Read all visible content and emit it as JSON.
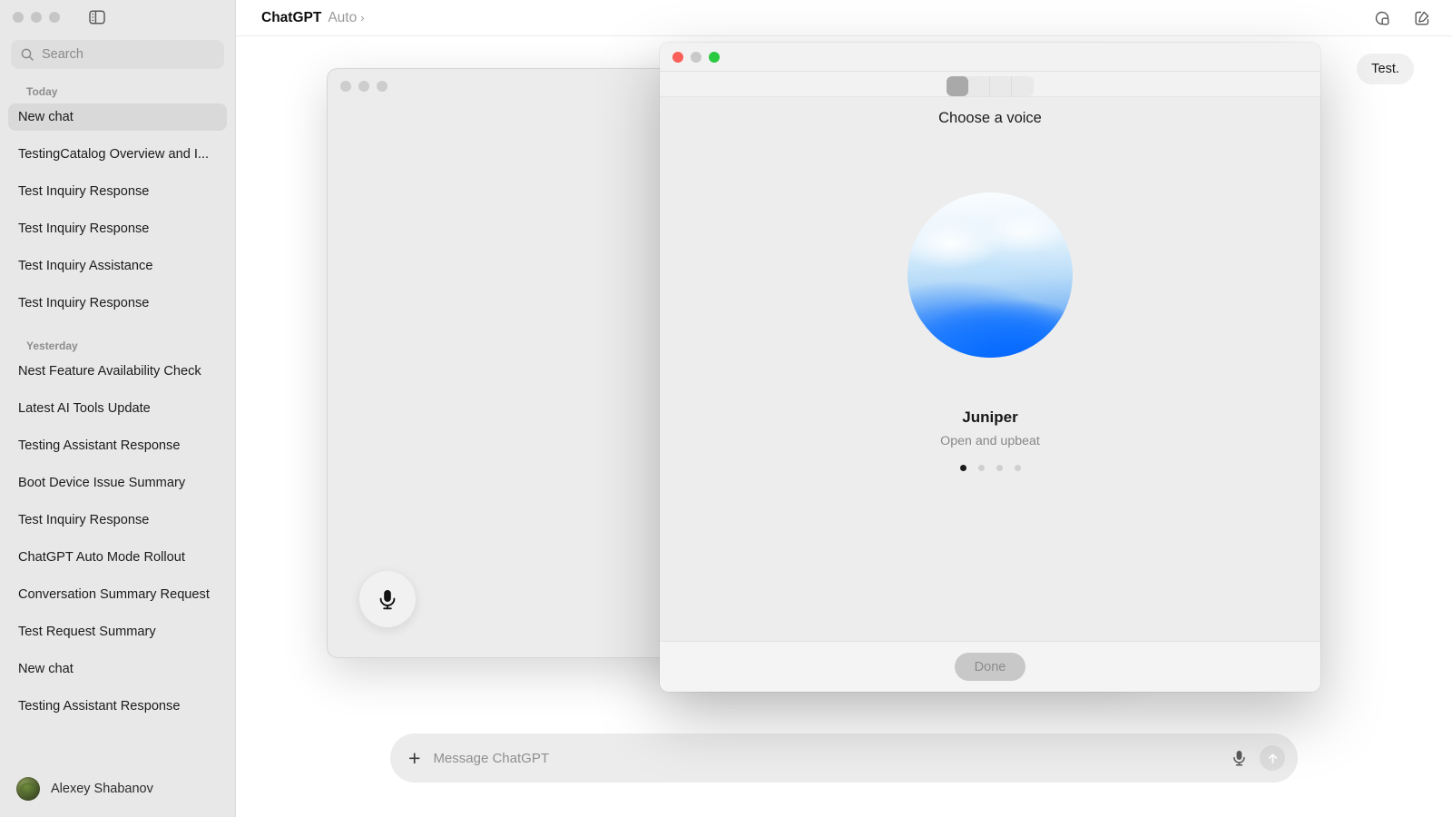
{
  "window": {
    "traffic_lights": [
      "close",
      "minimize",
      "maximize"
    ],
    "sidebar_toggle_icon": "sidebar-toggle-icon"
  },
  "sidebar": {
    "search": {
      "placeholder": "Search",
      "icon": "search-icon"
    },
    "sections": [
      {
        "label": "Today",
        "items": [
          {
            "title": "New chat",
            "active": true
          },
          {
            "title": "TestingCatalog Overview and I...",
            "active": false
          },
          {
            "title": "Test Inquiry Response",
            "active": false
          },
          {
            "title": "Test Inquiry Response",
            "active": false
          },
          {
            "title": "Test Inquiry Assistance",
            "active": false
          },
          {
            "title": "Test Inquiry Response",
            "active": false
          }
        ]
      },
      {
        "label": "Yesterday",
        "items": [
          {
            "title": "Nest Feature Availability Check",
            "active": false
          },
          {
            "title": "Latest AI Tools Update",
            "active": false
          },
          {
            "title": "Testing Assistant Response",
            "active": false
          },
          {
            "title": "Boot Device Issue Summary",
            "active": false
          },
          {
            "title": "Test Inquiry Response",
            "active": false
          },
          {
            "title": "ChatGPT Auto Mode Rollout",
            "active": false
          },
          {
            "title": "Conversation Summary Request",
            "active": false
          },
          {
            "title": "Test Request Summary",
            "active": false
          },
          {
            "title": "New chat",
            "active": false
          },
          {
            "title": "Testing Assistant Response",
            "active": false
          }
        ]
      }
    ],
    "account": {
      "name": "Alexey Shabanov",
      "avatar": "user-avatar"
    }
  },
  "topbar": {
    "brand": "ChatGPT",
    "model": "Auto",
    "chevron": "›",
    "temporary_chat_icon": "temporary-chat-icon",
    "new_chat_icon": "new-chat-icon"
  },
  "conversation": {
    "messages": [
      {
        "role": "user",
        "text": "Test."
      }
    ]
  },
  "composer": {
    "add_icon": "plus-icon",
    "placeholder": "Message ChatGPT",
    "mic_icon": "microphone-icon",
    "send_icon": "send-arrow-icon"
  },
  "voice_window": {
    "settings_icon": "voice-settings-icon",
    "mic_button_icon": "microphone-icon",
    "end_call_button": "end-call-button"
  },
  "voice_modal": {
    "title": "Choose a voice",
    "segments": [
      {
        "id": "segment-1",
        "selected": true
      },
      {
        "id": "segment-2",
        "selected": false
      },
      {
        "id": "segment-3",
        "selected": false
      },
      {
        "id": "segment-4",
        "selected": false
      }
    ],
    "voice": {
      "name": "Juniper",
      "description": "Open and upbeat",
      "orb": "voice-orb"
    },
    "pagination": {
      "count": 4,
      "active_index": 0
    },
    "done_label": "Done"
  },
  "colors": {
    "sidebar_bg": "#e8e8e8",
    "active_item": "#d9d9d9",
    "accent_blue": "#0a6bff",
    "end_call_red": "#e0514e",
    "traffic_red": "#fc5f57",
    "traffic_green": "#29c940"
  }
}
